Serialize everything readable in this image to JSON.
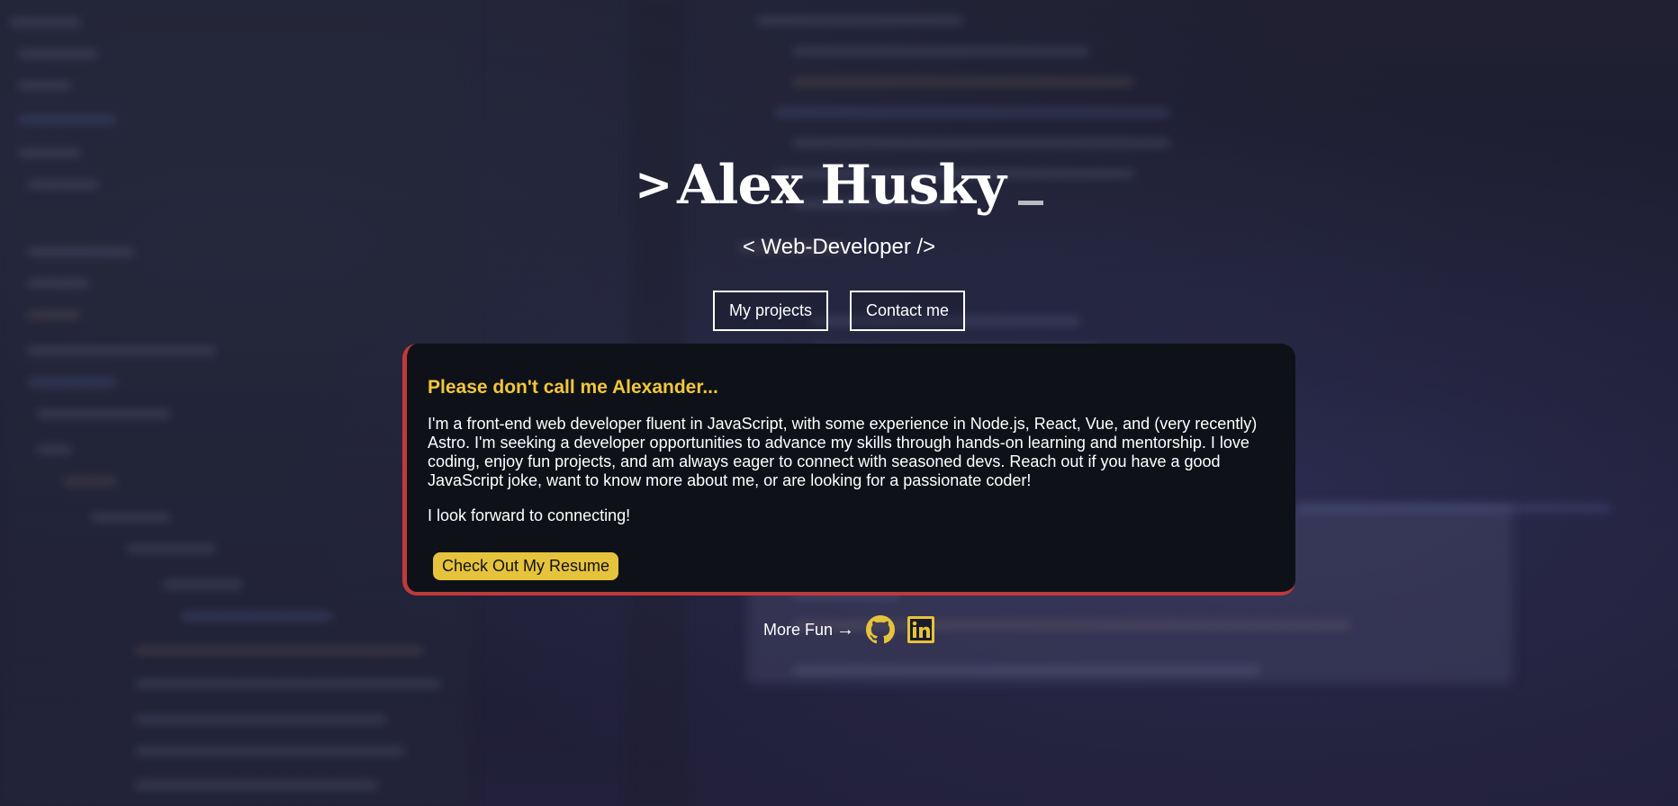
{
  "hero": {
    "prompt_symbol": ">",
    "name": "Alex Husky",
    "subtitle": "< Web-Developer />"
  },
  "actions": {
    "projects_label": "My projects",
    "contact_label": "Contact me"
  },
  "about": {
    "heading": "Please don't call me Alexander...",
    "paragraph_1": "I'm a front-end web developer fluent in JavaScript, with some experience in Node.js, React, Vue, and (very recently) Astro. I'm seeking a developer opportunities to advance my skills through hands-on learning and mentorship. I love coding, enjoy fun projects, and am always eager to connect with seasoned devs. Reach out if you have a good JavaScript joke, want to know more about me, or are looking for a passionate coder!",
    "paragraph_2": "I look forward to connecting!",
    "resume_label": "Check Out My Resume"
  },
  "footer": {
    "more_label": "More Fun",
    "arrow_icon": "arrow-right-icon",
    "links": [
      {
        "icon": "github-icon"
      },
      {
        "icon": "linkedin-icon"
      }
    ]
  },
  "colors": {
    "accent_yellow": "#e5c33c",
    "heading_yellow": "#f3c63a",
    "card_border_red": "#c0393b",
    "card_background": "#0e1218"
  }
}
